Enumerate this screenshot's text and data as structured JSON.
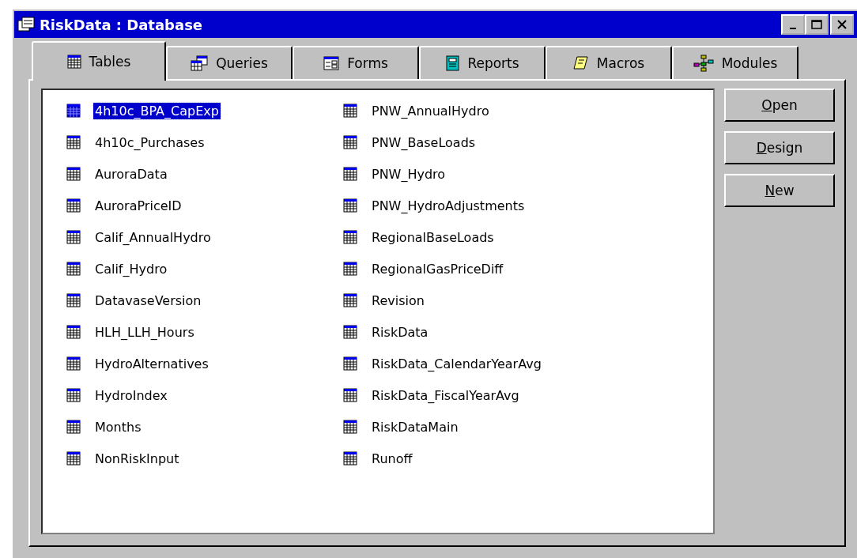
{
  "window": {
    "title": "RiskData : Database"
  },
  "tabs": [
    {
      "label": "Tables",
      "selected": true,
      "kind": "table"
    },
    {
      "label": "Queries",
      "selected": false,
      "kind": "query"
    },
    {
      "label": "Forms",
      "selected": false,
      "kind": "form"
    },
    {
      "label": "Reports",
      "selected": false,
      "kind": "report"
    },
    {
      "label": "Macros",
      "selected": false,
      "kind": "macro"
    },
    {
      "label": "Modules",
      "selected": false,
      "kind": "module"
    }
  ],
  "objects": [
    {
      "name": "4h10c_BPA_CapExp",
      "selected": true
    },
    {
      "name": "4h10c_Purchases",
      "selected": false
    },
    {
      "name": "AuroraData",
      "selected": false
    },
    {
      "name": "AuroraPriceID",
      "selected": false
    },
    {
      "name": "Calif_AnnualHydro",
      "selected": false
    },
    {
      "name": "Calif_Hydro",
      "selected": false
    },
    {
      "name": "DatavaseVersion",
      "selected": false
    },
    {
      "name": "HLH_LLH_Hours",
      "selected": false
    },
    {
      "name": "HydroAlternatives",
      "selected": false
    },
    {
      "name": "HydroIndex",
      "selected": false
    },
    {
      "name": "Months",
      "selected": false
    },
    {
      "name": "NonRiskInput",
      "selected": false
    },
    {
      "name": "PNW_AnnualHydro",
      "selected": false
    },
    {
      "name": "PNW_BaseLoads",
      "selected": false
    },
    {
      "name": "PNW_Hydro",
      "selected": false
    },
    {
      "name": "PNW_HydroAdjustments",
      "selected": false
    },
    {
      "name": "RegionalBaseLoads",
      "selected": false
    },
    {
      "name": "RegionalGasPriceDiff",
      "selected": false
    },
    {
      "name": "Revision",
      "selected": false
    },
    {
      "name": "RiskData",
      "selected": false
    },
    {
      "name": "RiskData_CalendarYearAvg",
      "selected": false
    },
    {
      "name": "RiskData_FiscalYearAvg",
      "selected": false
    },
    {
      "name": "RiskDataMain",
      "selected": false
    },
    {
      "name": "Runoff",
      "selected": false
    }
  ],
  "buttons": [
    {
      "label": "Open",
      "first_letter_underlined": true
    },
    {
      "label": "Design",
      "first_letter_underlined": true
    },
    {
      "label": "New",
      "first_letter_underlined": true
    }
  ]
}
